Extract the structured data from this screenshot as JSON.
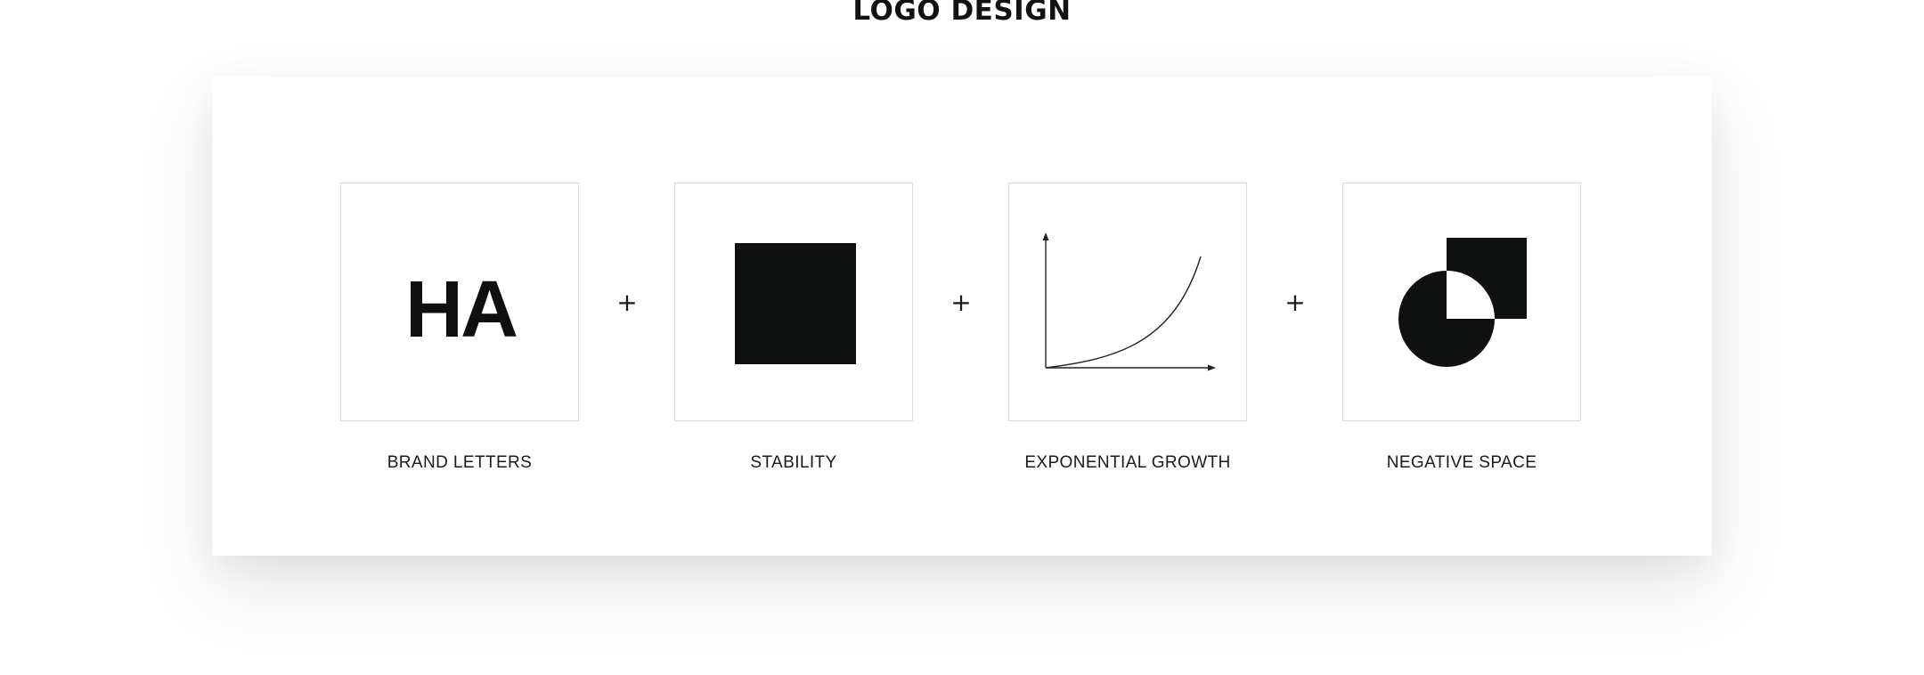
{
  "title": "LOGO DESIGN",
  "operator": "+",
  "tiles": [
    {
      "icon": "brand-letters-mark",
      "mark_text": "HA",
      "label": "BRAND LETTERS"
    },
    {
      "icon": "solid-square-icon",
      "label": "STABILITY"
    },
    {
      "icon": "exponential-curve-icon",
      "label": "EXPONENTIAL GROWTH"
    },
    {
      "icon": "negative-space-icon",
      "label": "NEGATIVE SPACE"
    }
  ],
  "colors": {
    "ink": "#0f1110",
    "border": "#d9d9d9",
    "background": "#ffffff"
  }
}
